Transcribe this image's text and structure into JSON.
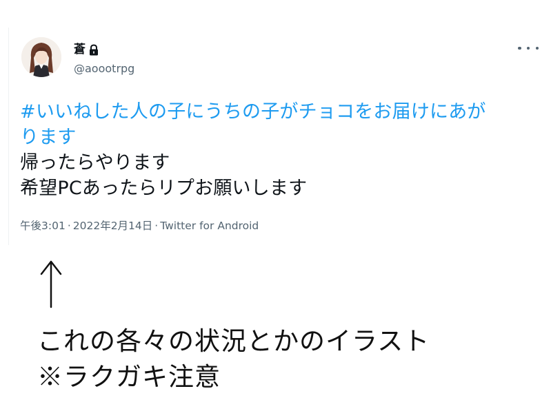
{
  "tweet": {
    "display_name": "蒼",
    "lock_icon": "lock-icon",
    "handle": "@aoootrpg",
    "more_icon": "more-horizontal-icon",
    "hashtag_line1": "#いいねした人の子にうちの子がチョコをお届けにあが",
    "hashtag_line2": "ります",
    "body_line1": "帰ったらやります",
    "body_line2": "希望PCあったらリプお願いします",
    "time": "午後3:01",
    "separator": "·",
    "date": "2022年2月14日",
    "source": "Twitter for Android",
    "hashtag_color": "#1d9bf0"
  },
  "annotation": {
    "arrow_icon": "up-arrow-icon",
    "caption_line1": "これの各々の状況とかのイラスト",
    "caption_line2": "※ラクガキ注意"
  }
}
